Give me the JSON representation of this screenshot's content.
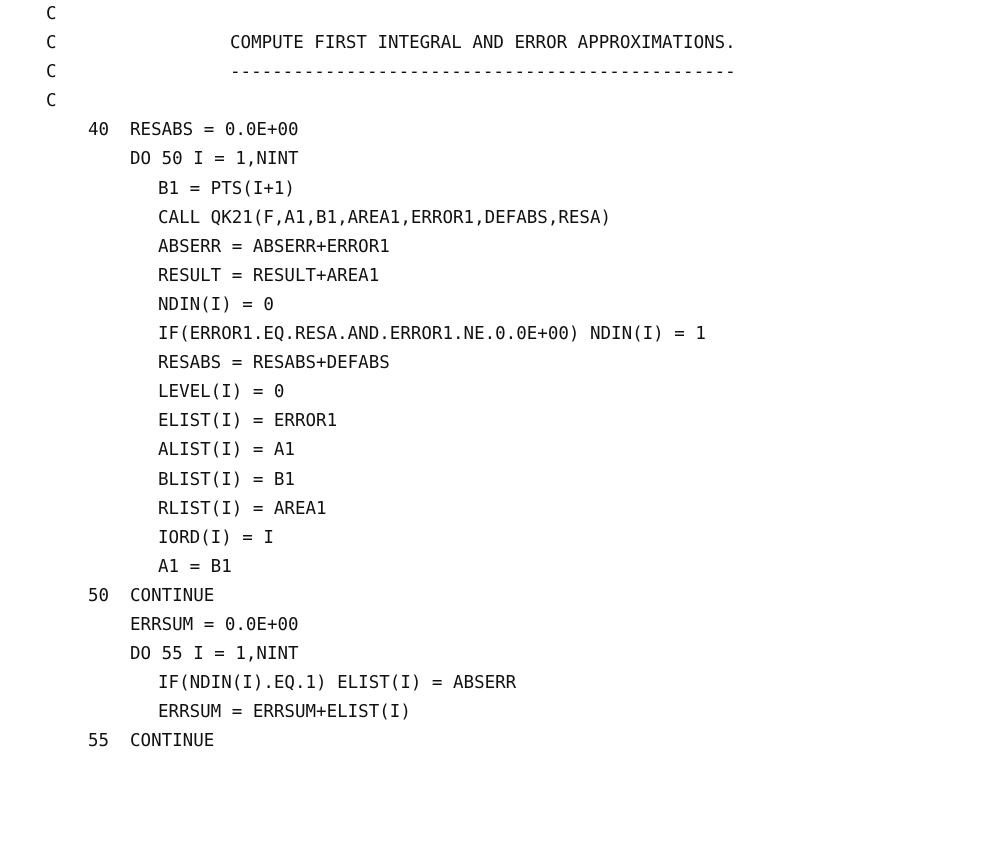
{
  "comments": {
    "c1": "C",
    "c2": "C",
    "c2_text": "COMPUTE FIRST INTEGRAL AND ERROR APPROXIMATIONS.",
    "c3": "C",
    "c3_text": "------------------------------------------------",
    "c4": "C"
  },
  "code": {
    "l40_label": "40",
    "l40": "RESABS = 0.0E+00",
    "do50": "DO 50 I = 1,NINT",
    "b1": "B1 = PTS(I+1)",
    "call": "CALL QK21(F,A1,B1,AREA1,ERROR1,DEFABS,RESA)",
    "abserr": "ABSERR = ABSERR+ERROR1",
    "result": "RESULT = RESULT+AREA1",
    "ndin0": "NDIN(I) = 0",
    "if_ndin": "IF(ERROR1.EQ.RESA.AND.ERROR1.NE.0.0E+00) NDIN(I) = 1",
    "resabs": "RESABS = RESABS+DEFABS",
    "level": "LEVEL(I) = 0",
    "elist": "ELIST(I) = ERROR1",
    "alist": "ALIST(I) = A1",
    "blist": "BLIST(I) = B1",
    "rlist": "RLIST(I) = AREA1",
    "iord": "IORD(I) = I",
    "a1": "A1 = B1",
    "l50_label": "50",
    "l50": "CONTINUE",
    "errsum0": "ERRSUM = 0.0E+00",
    "do55": "DO 55 I = 1,NINT",
    "if_elist": "IF(NDIN(I).EQ.1) ELIST(I) = ABSERR",
    "errsum": "ERRSUM = ERRSUM+ELIST(I)",
    "l55_label": "55",
    "l55": "CONTINUE"
  }
}
